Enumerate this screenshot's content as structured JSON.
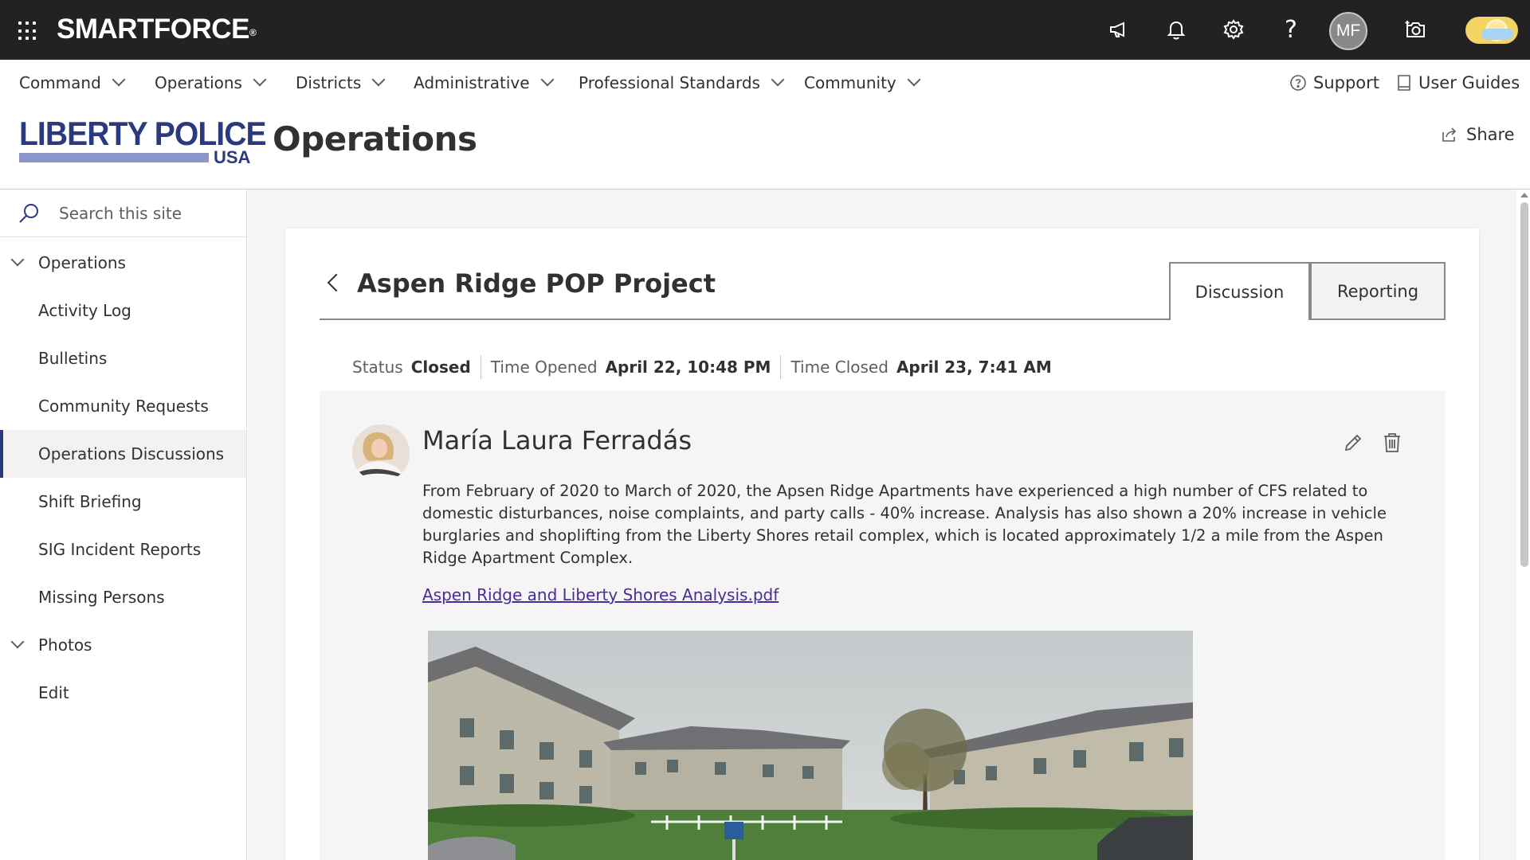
{
  "suite_bar": {
    "brand": "SMARTFORCE",
    "brand_mark": "®",
    "help_glyph": "?",
    "user_initials": "MF",
    "icons": [
      "waffle-icon",
      "megaphone-icon",
      "bell-icon",
      "gear-icon",
      "help-icon",
      "camera-icon",
      "theme-toggle-icon"
    ]
  },
  "top_nav": {
    "items": [
      {
        "label": "Command"
      },
      {
        "label": "Operations"
      },
      {
        "label": "Districts"
      },
      {
        "label": "Administrative"
      },
      {
        "label": "Professional Standards"
      },
      {
        "label": "Community"
      }
    ],
    "support_label": "Support",
    "user_guides_label": "User Guides"
  },
  "site_header": {
    "logo_line1": "LIBERTY POLICE",
    "logo_line2": "USA",
    "title": "Operations",
    "share_label": "Share"
  },
  "left_nav": {
    "search_placeholder": "Search this site",
    "items": [
      {
        "label": "Operations",
        "type": "header"
      },
      {
        "label": "Activity Log"
      },
      {
        "label": "Bulletins"
      },
      {
        "label": "Community Requests"
      },
      {
        "label": "Operations Discussions",
        "active": true
      },
      {
        "label": "Shift Briefing"
      },
      {
        "label": "SIG Incident Reports"
      },
      {
        "label": "Missing Persons"
      },
      {
        "label": "Photos",
        "type": "header"
      },
      {
        "label": "Edit"
      }
    ]
  },
  "discussion": {
    "title": "Aspen Ridge POP Project",
    "tabs": [
      {
        "label": "Discussion",
        "selected": true
      },
      {
        "label": "Reporting"
      }
    ],
    "meta": {
      "status_label": "Status",
      "status_value": "Closed",
      "opened_label": "Time Opened",
      "opened_value": "April 22, 10:48 PM",
      "closed_label": "Time Closed",
      "closed_value": "April 23, 7:41 AM"
    },
    "post": {
      "author": "María Laura Ferradás",
      "body": "From February of 2020 to March of 2020, the Apsen Ridge Apartments have experienced a high number of CFS related to domestic disturbances, noise complaints, and party calls - 40% increase. Analysis has also shown a 20% increase in vehicle burglaries and shoplifting from the Liberty Shores retail complex, which is located approximately 1/2 a mile from the Aspen Ridge Apartment Complex.",
      "attachment": "Aspen Ridge and Liberty Shores Analysis.pdf"
    }
  },
  "colors": {
    "suite_bar_bg": "#222222",
    "brand_blue": "#2b3a7e",
    "link_purple": "#4b2a9b",
    "canvas_bg": "#f5f5f5"
  }
}
